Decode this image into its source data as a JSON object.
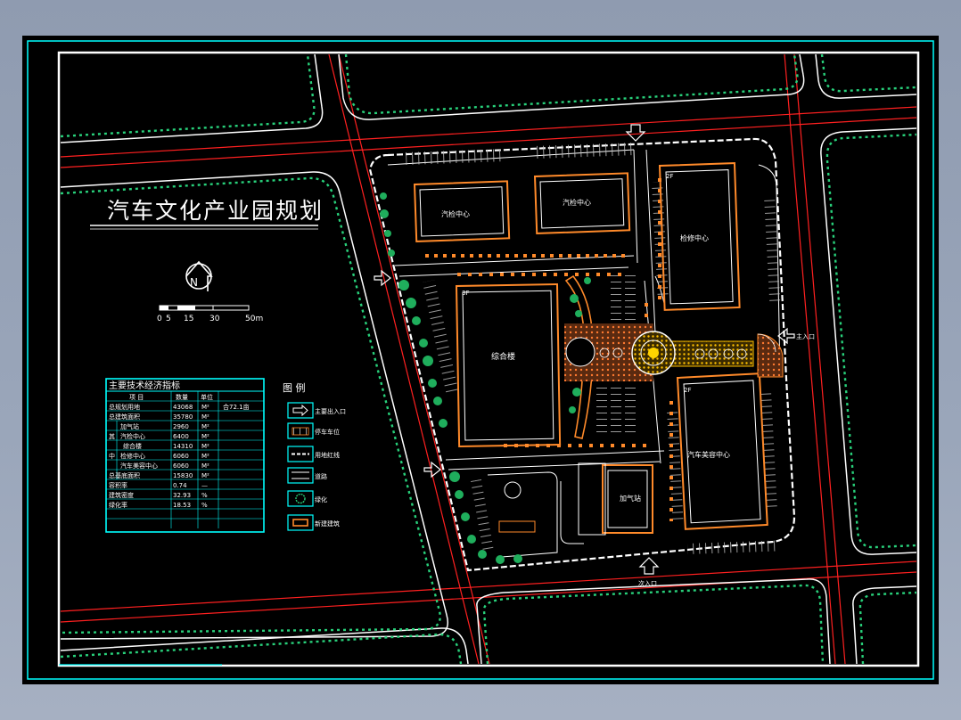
{
  "title": "汽车文化产业园规划",
  "north_label": "N",
  "scale": {
    "ticks": [
      "0",
      "5",
      "15",
      "30",
      "50m"
    ]
  },
  "indicators": {
    "heading": "主要技术经济指标",
    "columns": [
      "项 目",
      "数量",
      "单位",
      ""
    ],
    "rows": [
      [
        "总规划用地",
        "43068",
        "M²",
        "合72.1亩"
      ],
      [
        "总建筑面积",
        "35780",
        "M²",
        ""
      ],
      [
        "加气站",
        "2960",
        "M²",
        ""
      ],
      [
        "汽检中心",
        "6400",
        "M²",
        ""
      ],
      [
        "综合楼",
        "14310",
        "M²",
        ""
      ],
      [
        "检修中心",
        "6060",
        "M²",
        ""
      ],
      [
        "汽车美容中心",
        "6060",
        "M²",
        ""
      ],
      [
        "总基底面积",
        "15830",
        "M²",
        ""
      ],
      [
        "容积率",
        "0.74",
        "—",
        ""
      ],
      [
        "建筑密度",
        "32.93",
        "%",
        ""
      ],
      [
        "绿化率",
        "18.53",
        "%",
        ""
      ]
    ],
    "group_labels": [
      "其",
      "中"
    ]
  },
  "legend": {
    "heading": "图 例",
    "items": [
      "主要出入口",
      "停车车位",
      "用地红线",
      "道路",
      "绿化",
      "新建建筑"
    ]
  },
  "buildings": {
    "inspection_a": "汽检中心",
    "inspection_b": "汽检中心",
    "repair": "检修中心",
    "floor_repair": "2F",
    "complex": "综合楼",
    "floor_complex": "3F",
    "beauty": "汽车美容中心",
    "floor_beauty": "2F",
    "gas": "加气站"
  },
  "entrances": {
    "east": "主入口",
    "south": "次入口"
  },
  "colors": {
    "background": "#000000",
    "frame": "#00ffff",
    "road_red": "#ff2020",
    "tree_green": "#28d07a",
    "building": "#ff8a2a",
    "white_line": "#ffffff",
    "plaza_yellow": "#ffd400"
  }
}
